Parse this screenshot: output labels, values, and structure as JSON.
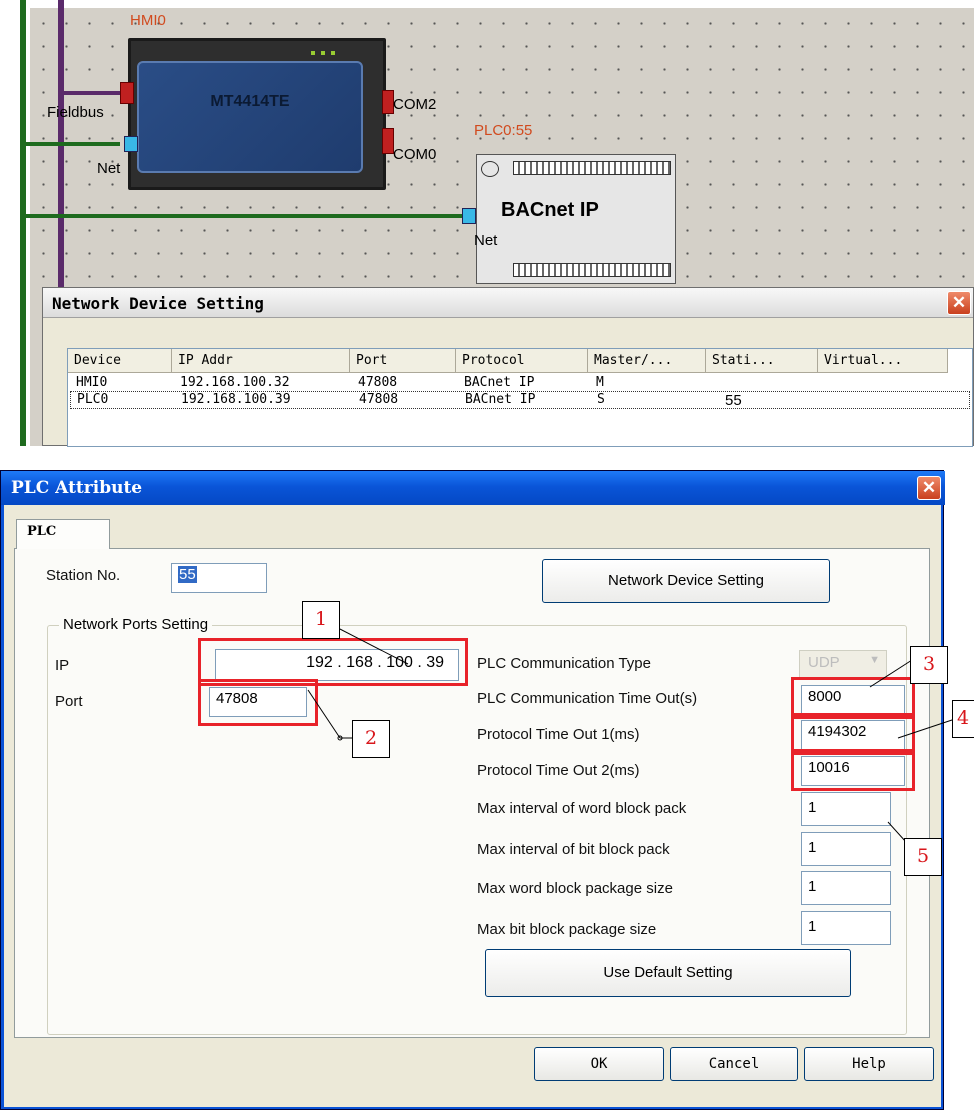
{
  "diagram": {
    "hmi": {
      "name": "HMI0",
      "model": "MT4414TE",
      "port_com2": "COM2",
      "port_com0": "COM0",
      "port_fieldbus": "Fieldbus",
      "port_net": "Net"
    },
    "plc": {
      "name": "PLC0:55",
      "label": "BACnet IP",
      "port_net": "Net"
    }
  },
  "network_dialog": {
    "title": "Network Device Setting",
    "close": "✕",
    "columns": [
      "Device",
      "IP Addr",
      "Port",
      "Protocol",
      "Master/...",
      "Stati...",
      "Virtual..."
    ],
    "rows": [
      [
        "HMI0",
        "192.168.100.32",
        "47808",
        "BACnet IP",
        "M",
        "",
        ""
      ],
      [
        "PLC0",
        "192.168.100.39",
        "47808",
        "BACnet IP",
        "S",
        "55",
        ""
      ]
    ]
  },
  "plc_dialog": {
    "title": "PLC Attribute",
    "close": "✕",
    "tab": "PLC",
    "station_label": "Station No.",
    "station_value": "55",
    "network_device_button": "Network Device Setting",
    "ports_group": "Network Ports Setting",
    "ip_label": "IP",
    "ip_value": "192 . 168 . 100 . 39",
    "port_label": "Port",
    "port_value": "47808",
    "comm_type_label": "PLC Communication Type",
    "comm_type_value": "UDP",
    "comm_timeout_label": "PLC Communication Time Out(s)",
    "comm_timeout_value": "8000",
    "proto_to1_label": "Protocol Time Out 1(ms)",
    "proto_to1_value": "4194302",
    "proto_to2_label": "Protocol Time Out 2(ms)",
    "proto_to2_value": "10016",
    "max_word_interval_label": "Max interval of word block pack",
    "max_word_interval_value": "1",
    "max_bit_interval_label": "Max interval of bit block pack",
    "max_bit_interval_value": "1",
    "max_word_size_label": "Max word block package size",
    "max_word_size_value": "1",
    "max_bit_size_label": "Max bit block package size",
    "max_bit_size_value": "1",
    "default_button": "Use Default Setting",
    "ok": "OK",
    "cancel": "Cancel",
    "help": "Help"
  },
  "callouts": [
    "1",
    "2",
    "3",
    "4",
    "5"
  ],
  "colors": {
    "highlight": "#e8232a",
    "callout_text": "#d8161b",
    "xp_title_blue": "#0a55d8",
    "dialog_face": "#ece9d8"
  }
}
